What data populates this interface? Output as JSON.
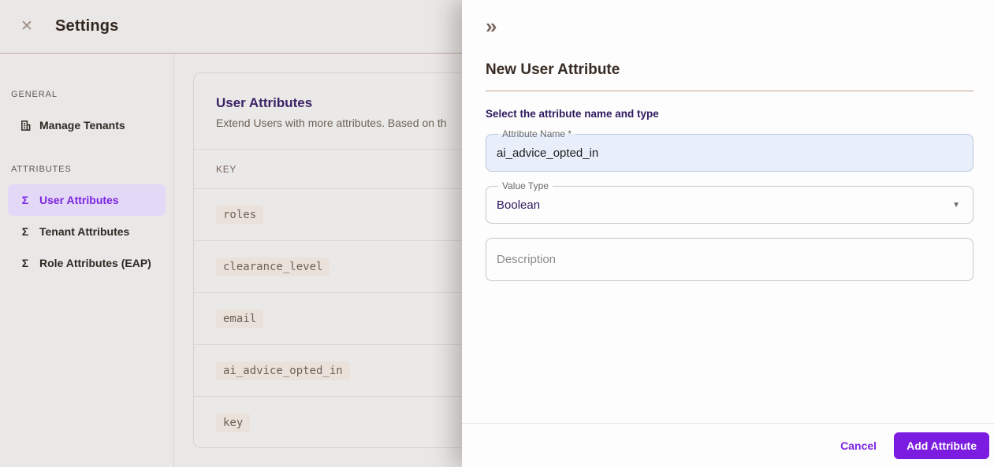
{
  "icons": {
    "close": "✕",
    "sigma": "Σ",
    "collapse": "»",
    "dropdown": "▼"
  },
  "header": {
    "title": "Settings"
  },
  "sidebar": {
    "sections": [
      {
        "label": "GENERAL",
        "items": [
          {
            "label": "Manage Tenants",
            "icon": "building-icon",
            "selected": false
          }
        ]
      },
      {
        "label": "ATTRIBUTES",
        "items": [
          {
            "label": "User Attributes",
            "icon": "sigma-icon",
            "selected": true
          },
          {
            "label": "Tenant Attributes",
            "icon": "sigma-icon",
            "selected": false
          },
          {
            "label": "Role Attributes (EAP)",
            "icon": "sigma-icon",
            "selected": false
          }
        ]
      }
    ]
  },
  "main": {
    "card": {
      "title": "User Attributes",
      "description": "Extend Users with more attributes. Based on th",
      "table": {
        "columns": [
          "KEY"
        ],
        "rows": [
          "roles",
          "clearance_level",
          "email",
          "ai_advice_opted_in",
          "key"
        ]
      }
    }
  },
  "drawer": {
    "title": "New User Attribute",
    "section_heading": "Select the attribute name and type",
    "fields": {
      "attribute_name": {
        "label": "Attribute Name *",
        "value": "ai_advice_opted_in"
      },
      "value_type": {
        "label": "Value Type",
        "value": "Boolean"
      },
      "description": {
        "placeholder": "Description"
      }
    },
    "footer": {
      "cancel_label": "Cancel",
      "submit_label": "Add Attribute"
    }
  },
  "colors": {
    "accent_purple": "#7c1ce1",
    "selected_item_bg": "#e3d8f6",
    "heading_purple": "#2d1a5e",
    "divider_tan": "#c7a28e",
    "autofill_blue": "#e8effb"
  }
}
